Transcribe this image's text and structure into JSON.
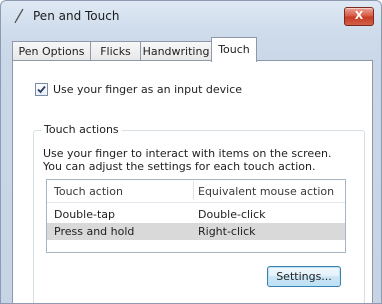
{
  "window": {
    "title": "Pen and Touch",
    "close_glyph": "X"
  },
  "tabs": [
    {
      "label": "Pen Options"
    },
    {
      "label": "Flicks"
    },
    {
      "label": "Handwriting"
    },
    {
      "label": "Touch"
    }
  ],
  "touch": {
    "use_finger": {
      "label": "Use your finger as an input device",
      "checked": true
    },
    "group_label": "Touch actions",
    "description": "Use your finger to interact with items on the screen. You can adjust the settings for each touch action.",
    "columns": [
      "Touch action",
      "Equivalent mouse action"
    ],
    "rows": [
      {
        "action": "Double-tap",
        "mouse": "Double-click"
      },
      {
        "action": "Press and hold",
        "mouse": "Right-click"
      }
    ],
    "settings_button": "Settings..."
  },
  "colors": {
    "selected_row": "#d9d9d9",
    "close_button": "#c63a23"
  },
  "icons": {
    "window_icon": "pen-icon",
    "close_icon": "close-icon",
    "checkbox_icon": "checkmark-icon"
  }
}
